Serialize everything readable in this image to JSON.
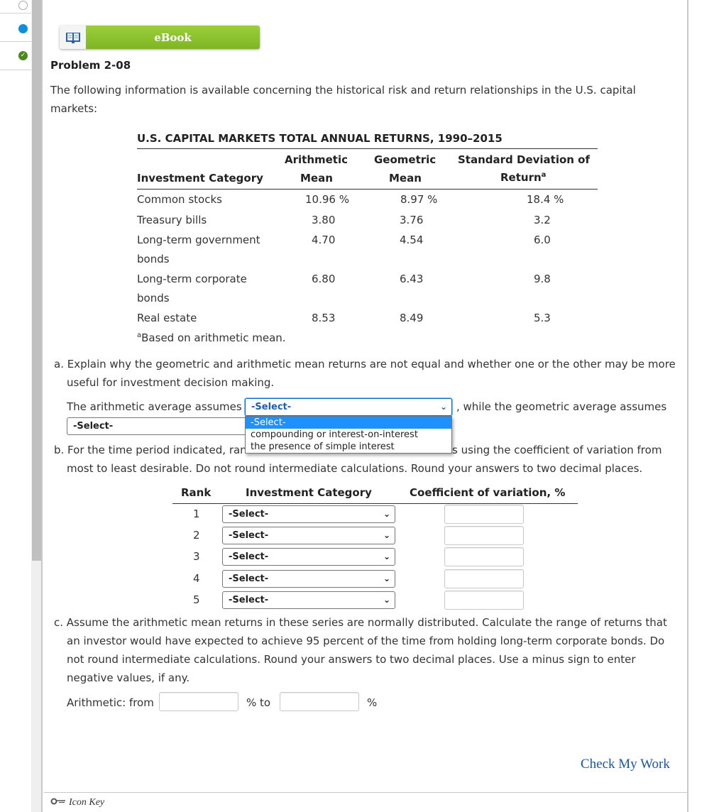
{
  "nav": {
    "items": [
      {
        "status": "unanswered"
      },
      {
        "status": "current"
      },
      {
        "status": "completed"
      }
    ]
  },
  "ebook": {
    "label": "eBook",
    "icon": "open-book-icon"
  },
  "problem": {
    "title": "Problem 2-08",
    "intro": "The following information is available concerning the historical risk and return relationships in the U.S. capital markets:"
  },
  "returns_table": {
    "title": "U.S. CAPITAL MARKETS TOTAL ANNUAL RETURNS, 1990–2015",
    "headers": {
      "category": "Investment Category",
      "arith_top": "Arithmetic",
      "arith_bottom": "Mean",
      "geo_top": "Geometric",
      "geo_bottom": "Mean",
      "sd_top": "Standard Deviation of",
      "sd_bottom": "Return",
      "sd_sup": "a"
    },
    "rows": [
      {
        "category_l1": "Common stocks",
        "category_l2": "",
        "arith": "10.96 %",
        "geo": "8.97 %",
        "sd": "18.4 %"
      },
      {
        "category_l1": "Treasury bills",
        "category_l2": "",
        "arith": "3.80",
        "geo": "3.76",
        "sd": "3.2"
      },
      {
        "category_l1": "Long-term government",
        "category_l2": "bonds",
        "arith": "4.70",
        "geo": "4.54",
        "sd": "6.0"
      },
      {
        "category_l1": "Long-term corporate",
        "category_l2": "bonds",
        "arith": "6.80",
        "geo": "6.43",
        "sd": "9.8"
      },
      {
        "category_l1": "Real estate",
        "category_l2": "",
        "arith": "8.53",
        "geo": "8.49",
        "sd": "5.3"
      }
    ],
    "footnote_sup": "a",
    "footnote": "Based on arithmetic mean."
  },
  "part_a": {
    "question_l1": "a. Explain why the geometric and arithmetic mean returns are not equal and whether one or the other may be more",
    "question_l2": "useful for investment decision making.",
    "sentence_start": "The arithmetic average assumes",
    "sentence_mid": ", while the geometric average assumes",
    "select1_value": "-Select-",
    "select2_value": "-Select-",
    "dropdown_options": [
      "-Select-",
      "compounding or interest-on-interest",
      "the presence of simple interest"
    ],
    "dropdown_selected_index": 0
  },
  "part_b": {
    "question_l1_left": "b. For the time period indicated, ran",
    "question_l1_right": "s using the coefficient of variation from",
    "question_l2": "most to least desirable. Do not round intermediate calculations. Round your answers to two decimal places.",
    "headers": {
      "rank": "Rank",
      "category": "Investment Category",
      "cv": "Coefficient of variation, %"
    },
    "rows": [
      {
        "rank": "1",
        "select": "-Select-",
        "cv": ""
      },
      {
        "rank": "2",
        "select": "-Select-",
        "cv": ""
      },
      {
        "rank": "3",
        "select": "-Select-",
        "cv": ""
      },
      {
        "rank": "4",
        "select": "-Select-",
        "cv": ""
      },
      {
        "rank": "5",
        "select": "-Select-",
        "cv": ""
      }
    ]
  },
  "part_c": {
    "question_l1": "c. Assume the arithmetic mean returns in these series are normally distributed. Calculate the range of returns that",
    "question_l2": "an investor would have expected to achieve 95 percent of the time from holding long-term corporate bonds. Do",
    "question_l3": "not round intermediate calculations. Round your answers to two decimal places. Use a minus sign to enter",
    "question_l4": "negative values, if any.",
    "label_from": "Arithmetic: from",
    "label_to": "% to",
    "label_pct": "%",
    "from_value": "",
    "to_value": ""
  },
  "footer": {
    "check_work": "Check My Work",
    "icon_key": "Icon Key"
  },
  "colors": {
    "ebook_green": "#8dc22f",
    "link_blue": "#1a55a8",
    "focus_blue": "#0f6bd0",
    "option_highlight": "#1e90ff",
    "nav_current": "#0f8ee0",
    "nav_completed": "#4a8a1c"
  }
}
